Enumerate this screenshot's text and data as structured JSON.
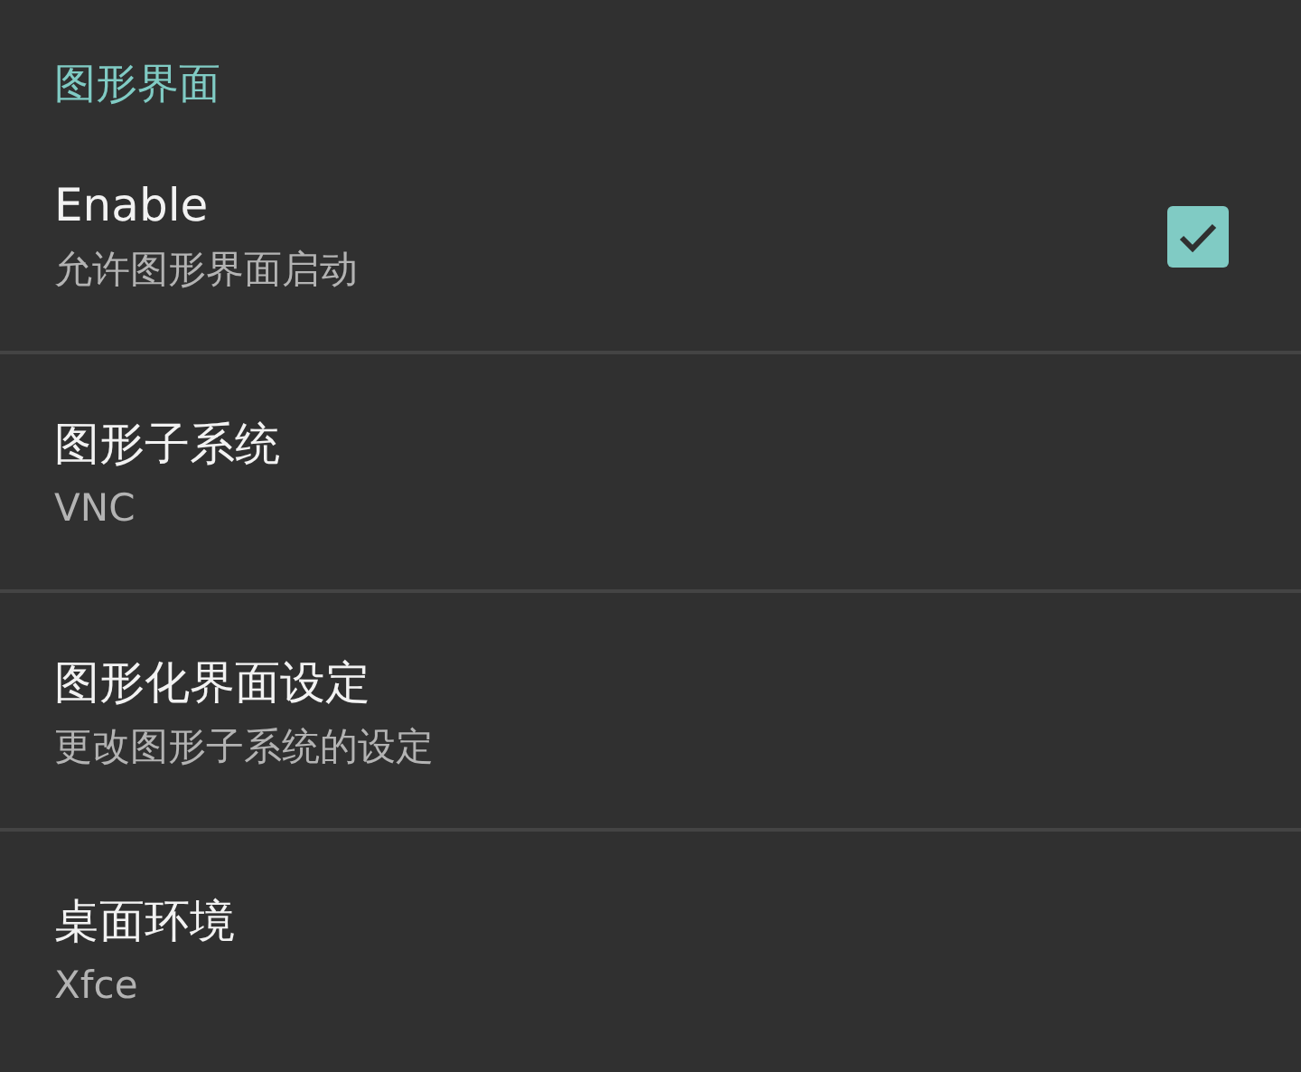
{
  "section": {
    "title": "图形界面"
  },
  "items": [
    {
      "kind": "checkbox",
      "title": "Enable",
      "summary": "允许图形界面启动",
      "checked": true
    },
    {
      "kind": "plain",
      "title": "图形子系统",
      "summary": "VNC"
    },
    {
      "kind": "plain",
      "title": "图形化界面设定",
      "summary": "更改图形子系统的设定"
    },
    {
      "kind": "plain",
      "title": "桌面环境",
      "summary": "Xfce"
    }
  ]
}
